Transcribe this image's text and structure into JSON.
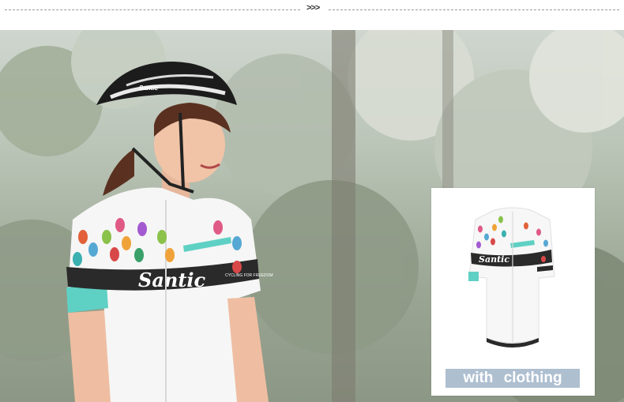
{
  "divider": {
    "arrows": ">>>"
  },
  "photo": {
    "jersey_brand": "Santic",
    "jersey_slogan": "CYCLING FOR FREEDOM",
    "helmet_brand": "Santic"
  },
  "product_card": {
    "jersey_brand": "Santic",
    "caption": "with clothing"
  },
  "colors": {
    "accent_teal": "#5fd0c4",
    "jersey_band": "#2a2a2a",
    "caption_bg": "#aebfd0"
  }
}
